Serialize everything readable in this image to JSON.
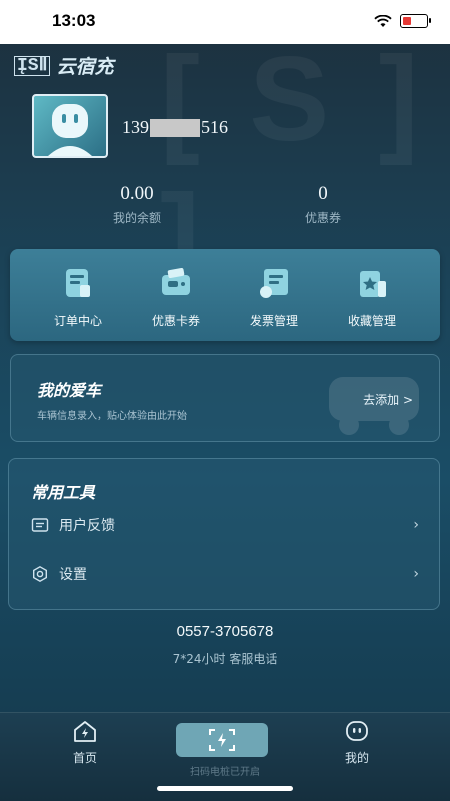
{
  "status_bar": {
    "time": "13:03"
  },
  "brand": {
    "logo": "ĮSⅡ",
    "name": "云宿充"
  },
  "user": {
    "phone_prefix": "139",
    "phone_suffix": "516"
  },
  "stats": {
    "balance": {
      "value": "0.00",
      "label": "我的余额"
    },
    "coupons": {
      "value": "0",
      "label": "优惠券"
    }
  },
  "quick_actions": [
    {
      "label": "订单中心",
      "icon": "order-icon"
    },
    {
      "label": "优惠卡券",
      "icon": "coupon-icon"
    },
    {
      "label": "发票管理",
      "icon": "invoice-icon"
    },
    {
      "label": "收藏管理",
      "icon": "favorite-icon"
    }
  ],
  "my_car": {
    "title": "我的爱车",
    "subtitle": "车辆信息录入，贴心体验由此开始",
    "add_label": "去添加 >"
  },
  "tools": {
    "title": "常用工具",
    "items": [
      {
        "label": "用户反馈",
        "icon": "feedback-icon"
      },
      {
        "label": "设置",
        "icon": "settings-icon"
      }
    ]
  },
  "hotline": {
    "phone": "0557-3705678",
    "hours": "7*24小时 客服电话"
  },
  "tabbar": {
    "home": "首页",
    "scan_caption": "扫码电桩已开启",
    "mine": "我的"
  },
  "colors": {
    "accent": "#6fa6b5",
    "card": "#3d7f98",
    "background": "#1b4358"
  }
}
